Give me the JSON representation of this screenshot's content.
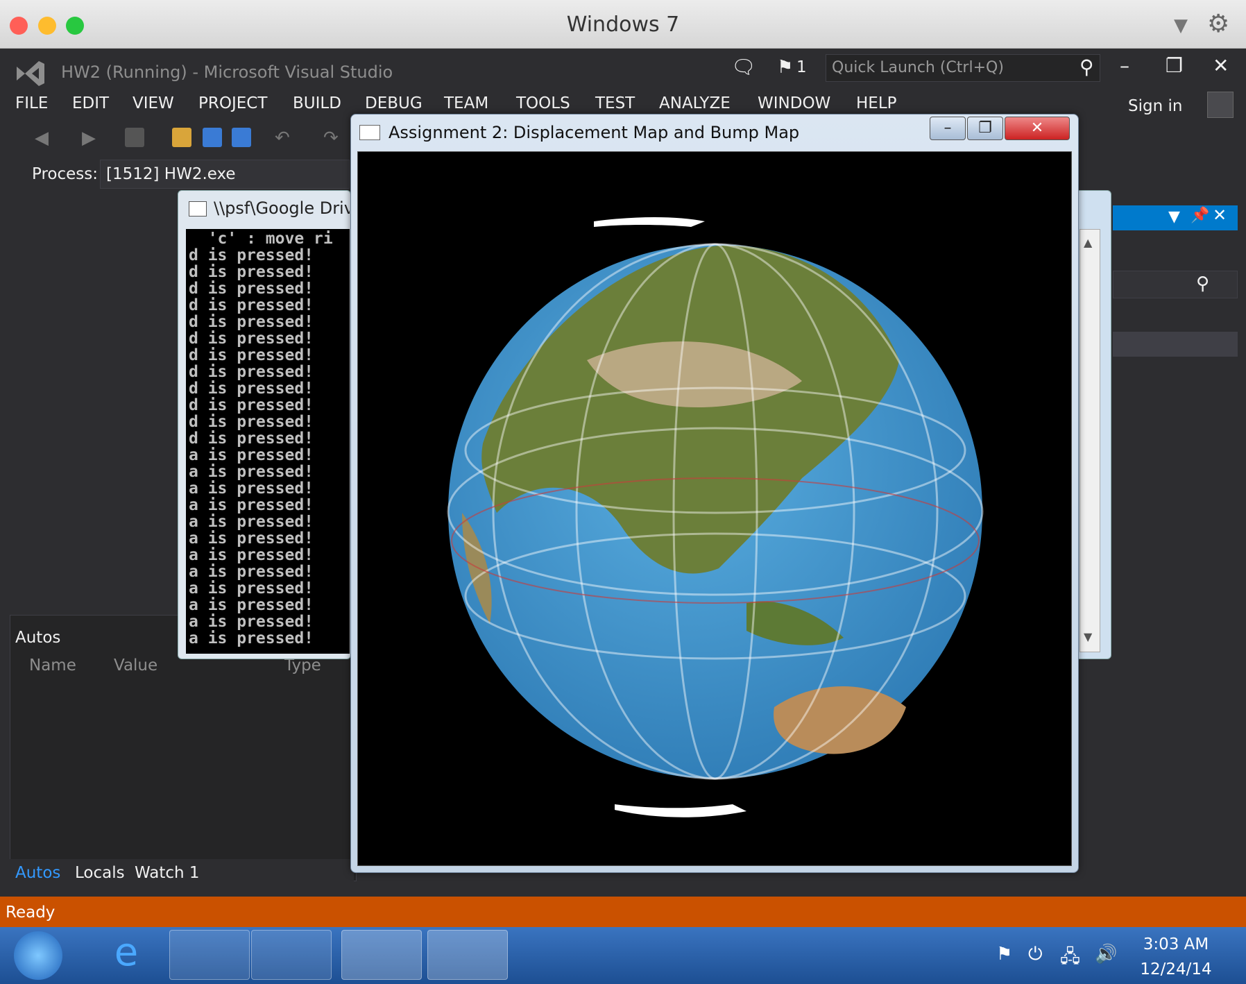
{
  "mac_window": {
    "title": "Windows 7"
  },
  "vs": {
    "title": "HW2 (Running) - Microsoft Visual Studio",
    "notifications_count": "1",
    "quick_launch_placeholder": "Quick Launch (Ctrl+Q)",
    "menu": [
      "FILE",
      "EDIT",
      "VIEW",
      "PROJECT",
      "BUILD",
      "DEBUG",
      "TEAM",
      "TOOLS",
      "TEST",
      "ANALYZE",
      "WINDOW",
      "HELP"
    ],
    "sign_in": "Sign in",
    "process_label": "Process:",
    "process_value": "[1512] HW2.exe"
  },
  "autos_panel": {
    "title": "Autos",
    "columns": [
      "Name",
      "Value",
      "Type"
    ],
    "tabs": [
      "Autos",
      "Locals",
      "Watch 1"
    ],
    "active_tab": "Autos"
  },
  "console": {
    "title": "\\\\psf\\Google Drive",
    "header_line": "  'c' : move ri",
    "lines": [
      "d is pressed!",
      "d is pressed!",
      "d is pressed!",
      "d is pressed!",
      "d is pressed!",
      "d is pressed!",
      "d is pressed!",
      "d is pressed!",
      "d is pressed!",
      "d is pressed!",
      "d is pressed!",
      "d is pressed!",
      "a is pressed!",
      "a is pressed!",
      "a is pressed!",
      "a is pressed!",
      "a is pressed!",
      "a is pressed!",
      "a is pressed!",
      "a is pressed!",
      "a is pressed!",
      "a is pressed!",
      "a is pressed!",
      "a is pressed!"
    ]
  },
  "gl_window": {
    "title": "Assignment 2: Displacement Map and Bump Map"
  },
  "status_bar": {
    "text": "Ready",
    "color": "#ca5100"
  },
  "taskbar": {
    "time": "3:03 AM",
    "date": "12/24/14"
  },
  "colors": {
    "vs_bg": "#2d2d30",
    "accent": "#007acc",
    "ocean": "#3b8fc7",
    "land": "#6b7f3a"
  }
}
